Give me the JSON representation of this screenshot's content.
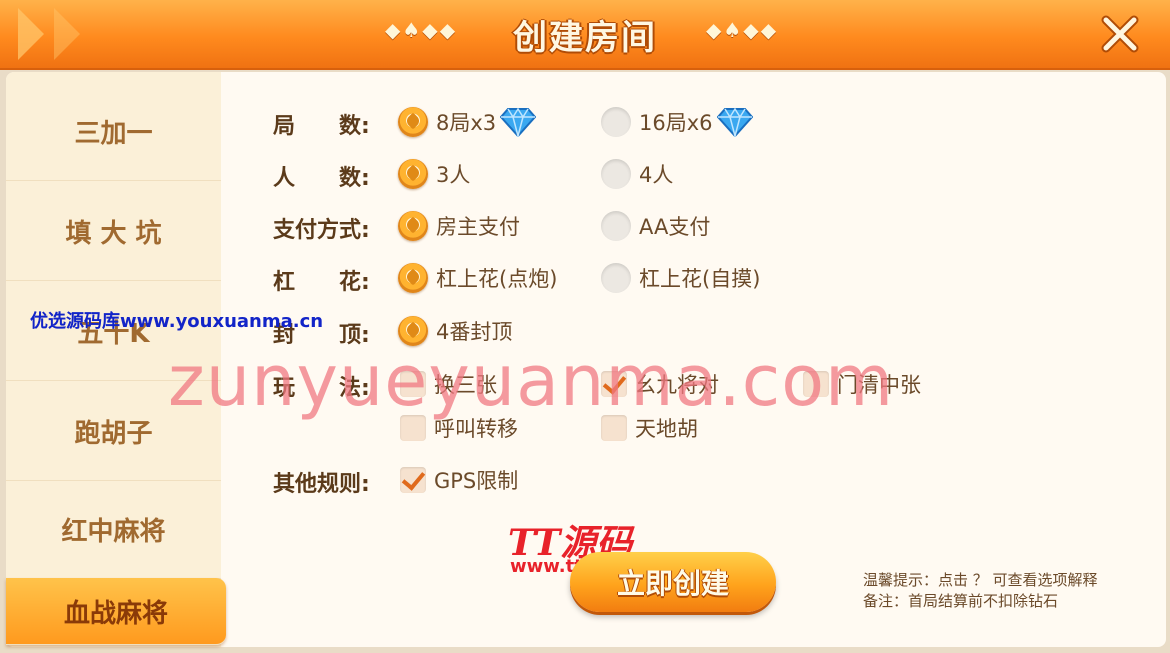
{
  "header": {
    "title": "创建房间",
    "deco_left": "◆♠◆◆",
    "deco_right": "◆♠◆◆",
    "close_icon": "close-x-icon"
  },
  "sidebar": {
    "items": [
      {
        "label": "三加一"
      },
      {
        "label": "填 大 坑"
      },
      {
        "label": "五十K"
      },
      {
        "label": "跑胡子"
      },
      {
        "label": "红中麻将"
      },
      {
        "label": "血战麻将",
        "active": true
      }
    ]
  },
  "form": {
    "rounds": {
      "label": "局　　数:",
      "options": [
        {
          "text": "8局x3",
          "selected": true
        },
        {
          "text": "16局x6",
          "selected": false
        }
      ]
    },
    "players": {
      "label": "人　　数:",
      "options": [
        {
          "text": "3人",
          "selected": true
        },
        {
          "text": "4人",
          "selected": false
        }
      ]
    },
    "payment": {
      "label": "支付方式:",
      "options": [
        {
          "text": "房主支付",
          "selected": true
        },
        {
          "text": "AA支付",
          "selected": false
        }
      ]
    },
    "gang": {
      "label": "杠　　花:",
      "options": [
        {
          "text": "杠上花(点炮)",
          "selected": true
        },
        {
          "text": "杠上花(自摸)",
          "selected": false
        }
      ]
    },
    "cap": {
      "label": "封　　顶:",
      "options": [
        {
          "text": "4番封顶",
          "selected": true
        }
      ]
    },
    "play": {
      "label": "玩　　法:",
      "options": [
        {
          "text": "换三张",
          "checked": false
        },
        {
          "text": "幺九将对",
          "checked": true
        },
        {
          "text": "门清中张",
          "checked": false
        },
        {
          "text": "呼叫转移",
          "checked": false
        },
        {
          "text": "天地胡",
          "checked": false
        }
      ]
    },
    "other": {
      "label": "其他规则:",
      "options": [
        {
          "text": "GPS限制",
          "checked": true
        }
      ]
    }
  },
  "create_button": "立即创建",
  "tips": {
    "line1": "温馨提示：点击 ？ 可查看选项解释",
    "line2": "备注：首局结算前不扣除钻石"
  },
  "watermarks": {
    "big": "zunyueyuanma.com",
    "small": "优选源码库www.youxuanma.cn",
    "tt": "TT源码",
    "tt_url": "www.ttym.cc"
  },
  "colors": {
    "accent": "#ff8a1e",
    "label": "#5b3a1a",
    "sidebar_text": "#a06a30"
  }
}
